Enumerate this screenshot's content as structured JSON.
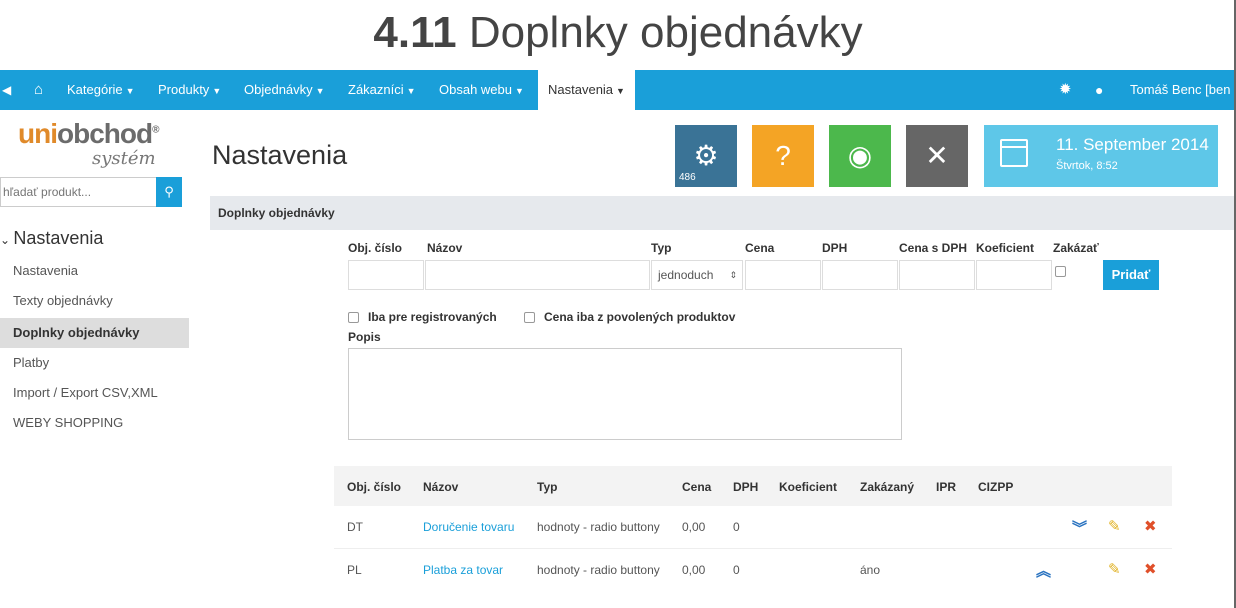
{
  "doc_title": {
    "number": "4.11",
    "text": "Doplnky objednávky"
  },
  "navbar": {
    "back_icon": "arrow-left-icon",
    "home_icon": "home-icon",
    "items": [
      "Kategórie",
      "Produkty",
      "Objednávky",
      "Zákazníci",
      "Obsah webu",
      "Nastavenia"
    ],
    "user": "Tomáš Benc [ben"
  },
  "logo": {
    "line1_a": "uni",
    "line1_b": "obchod",
    "reg": "®",
    "line2": "systém"
  },
  "search": {
    "placeholder": "hľadať produkt..."
  },
  "sidebar": {
    "heading": "Nastavenia",
    "items": [
      "Nastavenia",
      "Texty objednávky",
      "Doplnky objednávky",
      "Platby",
      "Import / Export CSV,XML",
      "WEBY SHOPPING"
    ],
    "active_index": 2
  },
  "page": {
    "title": "Nastavenia"
  },
  "tiles": {
    "settings_badge": "486"
  },
  "date": {
    "line1": "11. September 2014",
    "line2": "Štvrtok, 8:52"
  },
  "panel": {
    "title": "Doplnky objednávky"
  },
  "form": {
    "labels": [
      "Obj. číslo",
      "Názov",
      "Typ",
      "Cena",
      "DPH",
      "Cena s DPH",
      "Koeficient",
      "Zakázať"
    ],
    "type_value": "jednoduch",
    "add_label": "Pridať",
    "checkbox1": "Iba pre registrovaných",
    "checkbox2": "Cena iba z povolených produktov",
    "popis_label": "Popis"
  },
  "table": {
    "headers": [
      "Obj. číslo",
      "Názov",
      "Typ",
      "Cena",
      "DPH",
      "Koeficient",
      "Zakázaný",
      "IPR",
      "CIZPP"
    ],
    "rows": [
      {
        "code": "DT",
        "name": "Doručenie tovaru",
        "type": "hodnoty - radio buttony",
        "price": "0,00",
        "dph": "0",
        "disabled": ""
      },
      {
        "code": "PL",
        "name": "Platba za tovar",
        "type": "hodnoty - radio buttony",
        "price": "0,00",
        "dph": "0",
        "disabled": "áno"
      }
    ]
  },
  "colors": {
    "accent": "#1a9fd9",
    "tile_dark": "#3a7396",
    "tile_orange": "#f4a425",
    "tile_green": "#4cb84c",
    "tile_gray": "#666666",
    "tile_light": "#5ec7e8"
  }
}
